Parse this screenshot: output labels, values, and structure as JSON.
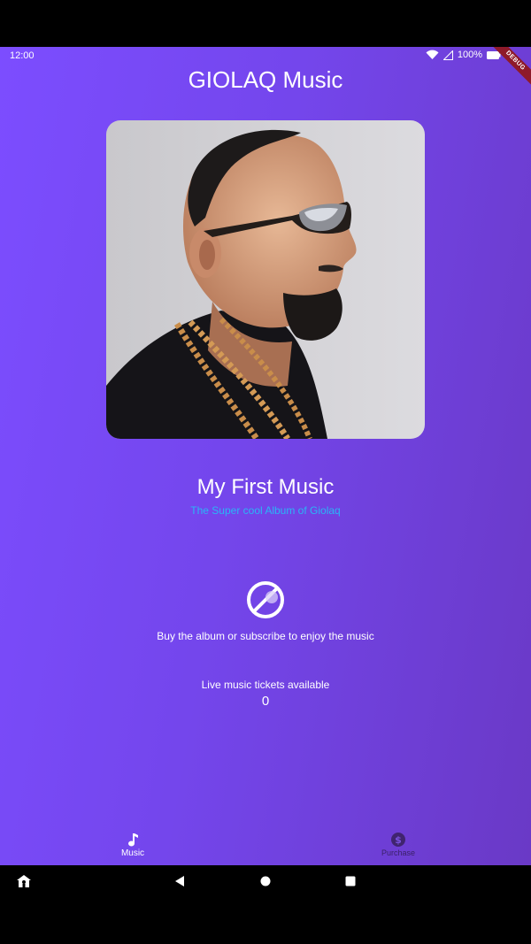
{
  "status_bar": {
    "time": "12:00",
    "battery": "100%",
    "debug_banner": "DEBUG"
  },
  "app": {
    "title": "GIOLAQ Music"
  },
  "track": {
    "title": "My First Music",
    "album": "The Super cool Album of Giolaq"
  },
  "access": {
    "icon": "blocked-icon",
    "message": "Buy the album or subscribe to enjoy the music"
  },
  "tickets": {
    "label": "Live music tickets available",
    "count": "0"
  },
  "bottom_nav": {
    "items": [
      {
        "label": "Music",
        "icon": "music-note-icon",
        "selected": true
      },
      {
        "label": "Purchase",
        "icon": "dollar-circle-icon",
        "selected": false
      }
    ]
  },
  "colors": {
    "gradient_start": "#7c4dff",
    "gradient_end": "#6a39c6",
    "subtitle": "#29b6f6",
    "nav_selected": "#ffffff",
    "nav_unselected": "#40246f"
  }
}
